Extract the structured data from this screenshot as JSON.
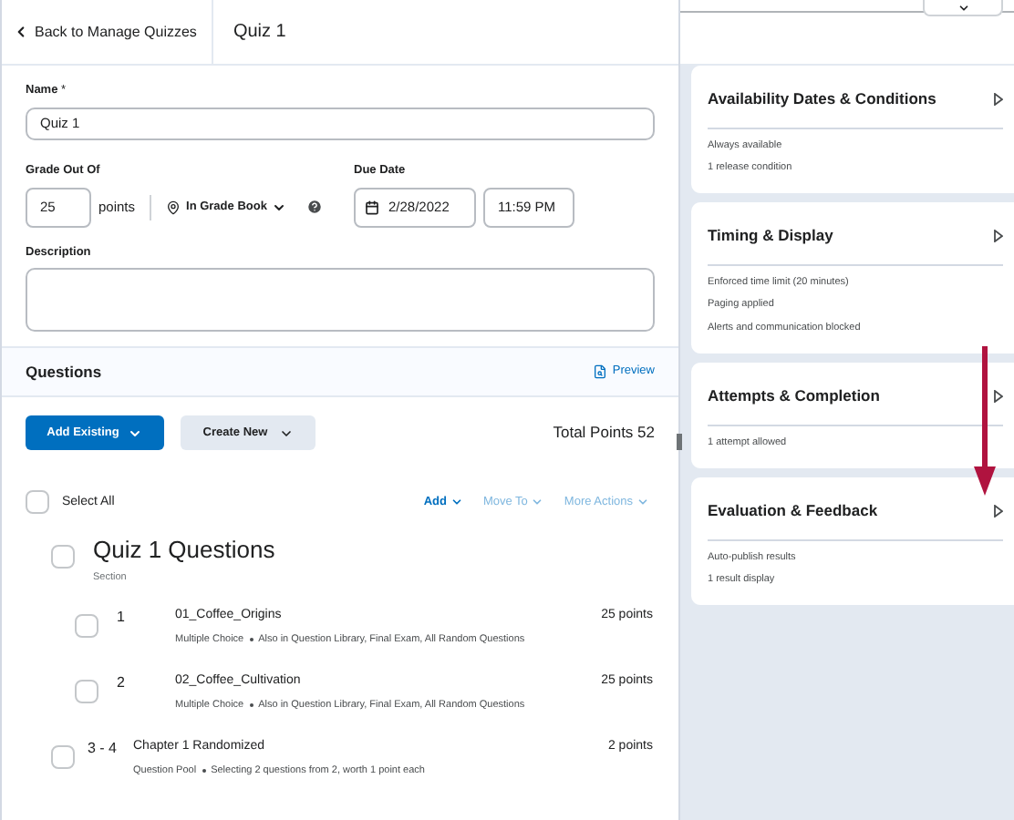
{
  "header": {
    "back_link": "Back to Manage Quizzes",
    "title": "Quiz 1"
  },
  "form": {
    "name_label": "Name",
    "required_mark": "*",
    "name_value": "Quiz 1",
    "grade_label": "Grade Out Of",
    "grade_value": "25",
    "points_unit": "points",
    "grade_book": "In Grade Book",
    "due_label": "Due Date",
    "due_date": "2/28/2022",
    "due_time": "11:59 PM",
    "description_label": "Description"
  },
  "questions": {
    "title": "Questions",
    "preview": "Preview",
    "add_existing": "Add Existing",
    "create_new": "Create New",
    "total_points": "Total Points 52",
    "select_all": {
      "label": "Select All",
      "checked": false
    },
    "actions": [
      {
        "label": "Add",
        "disabled": false
      },
      {
        "label": "Move To",
        "disabled": true
      },
      {
        "label": "More Actions",
        "disabled": true
      }
    ],
    "section": {
      "title": "Quiz 1 Questions",
      "subtitle": "Section",
      "checked": false
    },
    "items": [
      {
        "number": "1",
        "title": "01_Coffee_Origins",
        "points": "25 points",
        "type": "Multiple Choice",
        "meta": "Also in Question Library, Final Exam, All Random Questions",
        "checked": false,
        "kind": "question"
      },
      {
        "number": "2",
        "title": "02_Coffee_Cultivation",
        "points": "25 points",
        "type": "Multiple Choice",
        "meta": "Also in Question Library, Final Exam, All Random Questions",
        "checked": false,
        "kind": "question"
      },
      {
        "number": "3 - 4",
        "title": "Chapter 1 Randomized",
        "points": "2 points",
        "type": "Question Pool",
        "meta": "Selecting 2 questions from 2, worth 1 point each",
        "checked": false,
        "kind": "pool"
      }
    ]
  },
  "cards": [
    {
      "title": "Availability Dates & Conditions",
      "lines": [
        "Always available",
        "1 release condition"
      ]
    },
    {
      "title": "Timing & Display",
      "lines": [
        "Enforced time limit (20 minutes)",
        "Paging applied",
        "Alerts and communication blocked"
      ]
    },
    {
      "title": "Attempts & Completion",
      "lines": [
        "1 attempt allowed"
      ]
    },
    {
      "title": "Evaluation & Feedback",
      "lines": [
        "Auto-publish results",
        "1 result display"
      ]
    }
  ]
}
